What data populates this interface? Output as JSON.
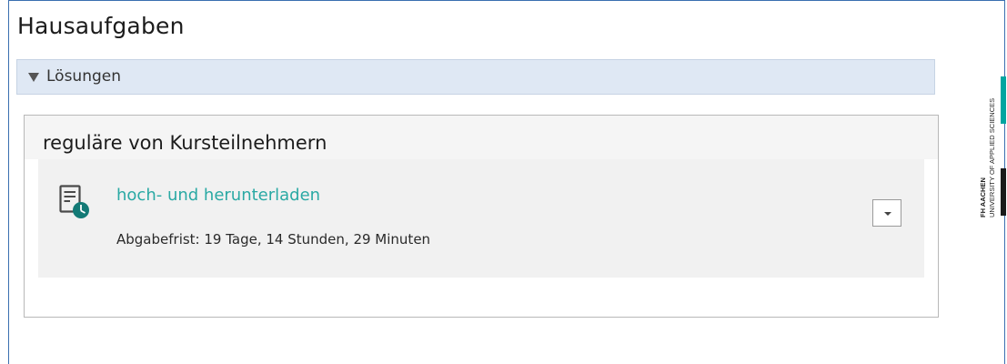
{
  "header": {
    "title": "Hausaufgaben"
  },
  "accordion": {
    "label": "Lösungen",
    "expanded": true,
    "icon": "triangle-down-icon"
  },
  "section": {
    "title": "reguläre von Kursteilnehmern",
    "items": [
      {
        "link_text": "hoch- und herunterladen",
        "deadline": "Abgabefrist: 19 Tage, 14 Stunden, 29 Minuten",
        "icon": "homework-clock-icon",
        "action_icon": "caret-down-icon"
      }
    ]
  },
  "logo": {
    "line1": "FH AACHEN",
    "line2": "UNIVERSITY OF APPLIED SCIENCES"
  },
  "colors": {
    "accent_teal": "#2aa9a4",
    "panel_border": "#3a6fb0",
    "accordion_bg": "#dfe8f4",
    "logo_teal": "#00a5a0"
  }
}
